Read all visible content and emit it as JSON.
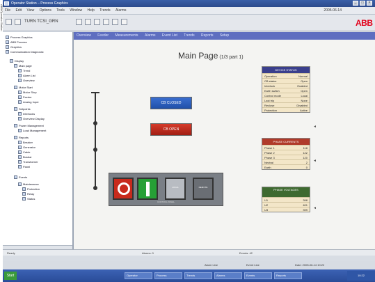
{
  "window": {
    "title": "Operator Station – Process Graphics"
  },
  "side_label": "ABB/Operator Station",
  "menu": {
    "items": [
      "File",
      "Edit",
      "View",
      "Options",
      "Tools",
      "Window",
      "Help",
      "Trends",
      "Alarms"
    ],
    "date": "2005-06-14"
  },
  "toolbar": {
    "text": "TURN TCSI_GRN"
  },
  "brand": "ABB",
  "tree": {
    "items": [
      "Process Graphics",
      "ABB Process",
      "Graphics",
      "Communication Diagnostic",
      "Display",
      "Main page",
      "Trend",
      "Alarm List",
      "Overview",
      "Motor Start",
      "Motor Stop",
      "Feeder",
      "Analog Input",
      "Setpoints",
      "Interlocks",
      "Overview Display",
      "Power Management",
      "Load Management",
      "Reports",
      "Breaker",
      "Generator",
      "Cable",
      "Busbar",
      "Transformer",
      "Panel",
      "Events",
      "Maintenance",
      "Protection",
      "Relay",
      "Status"
    ]
  },
  "main": {
    "nav": [
      "Overview",
      "Feeder",
      "Measurements",
      "Alarms",
      "Event List",
      "Trends",
      "Reports",
      "Setup"
    ],
    "title": "Main Page",
    "subtitle": "(1/3 part 1)",
    "btn_blue": "CB CLOSED",
    "btn_red": "CB OPEN",
    "panel_gray_label": "LOCAL",
    "panel_dark_label": "REMOTE",
    "panel_footer": "CONTROL PANEL"
  },
  "table1": {
    "header": "DEVICE STATUS",
    "rows": [
      {
        "label": "Operation",
        "value": "Normal"
      },
      {
        "label": "CB status",
        "value": "Open"
      },
      {
        "label": "Interlock",
        "value": "Enabled"
      },
      {
        "label": "Earth switch",
        "value": "Open"
      },
      {
        "label": "Control mode",
        "value": "Local"
      },
      {
        "label": "Last trip",
        "value": "None"
      },
      {
        "label": "Reclose",
        "value": "Disabled"
      },
      {
        "label": "Protection",
        "value": "Active"
      }
    ]
  },
  "table2": {
    "header": "PHASE CURRENTS",
    "rows": [
      {
        "label": "Phase 1",
        "value": "118"
      },
      {
        "label": "Phase 2",
        "value": "122"
      },
      {
        "label": "Phase 3",
        "value": "120"
      },
      {
        "label": "Neutral",
        "value": "2"
      },
      {
        "label": "Earth",
        "value": "0"
      }
    ]
  },
  "table3": {
    "header": "PHASE VOLTAGES",
    "rows": [
      {
        "label": "U1",
        "value": "398"
      },
      {
        "label": "U2",
        "value": "401"
      },
      {
        "label": "U3",
        "value": "399"
      }
    ]
  },
  "statusbar": {
    "left": "Ready",
    "mid": "Alarms: 0",
    "right": "Events: 42"
  },
  "taskbar_upper": {
    "a": "Alarm Line",
    "b": "Event Line",
    "c": "Date: 2005-06-14 10:22"
  },
  "taskbar": {
    "start": "Start",
    "tasks": [
      "Operator",
      "Process",
      "Trends",
      "Alarms",
      "Events",
      "Reports"
    ],
    "clock": "10:22"
  }
}
